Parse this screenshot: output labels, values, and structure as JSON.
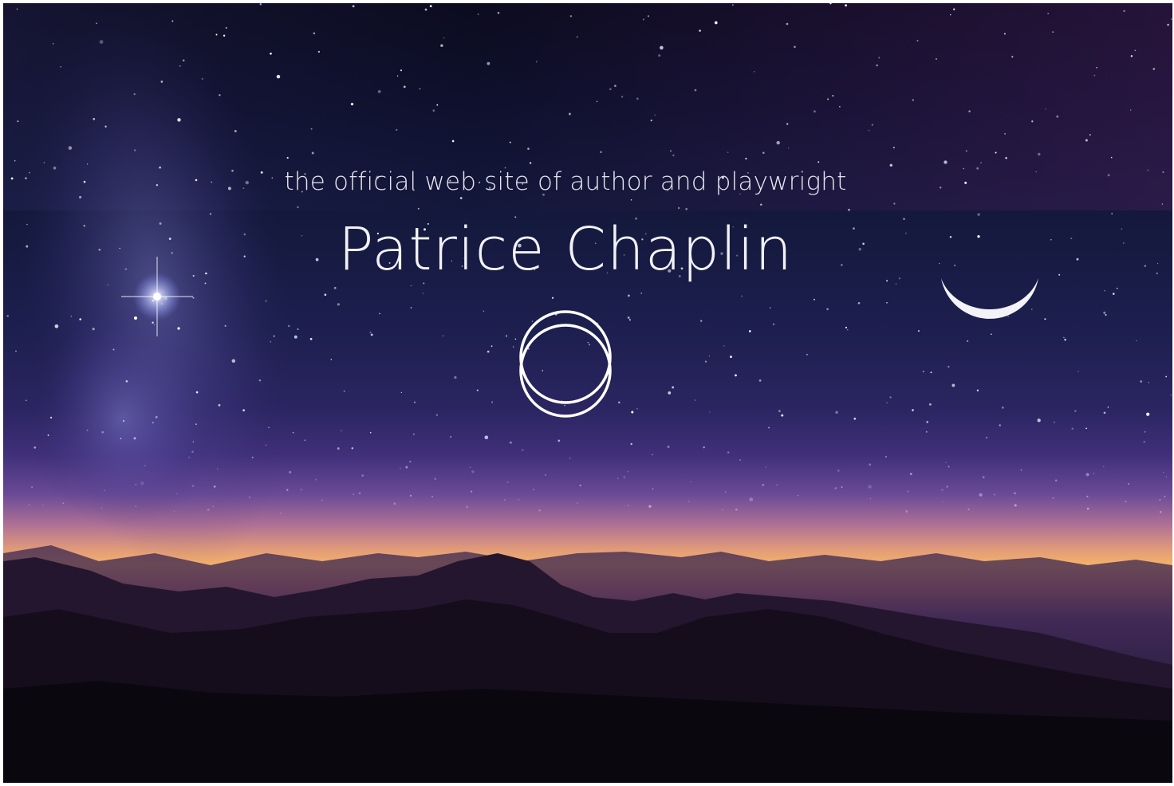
{
  "hero": {
    "tagline": "the official web site of author and playwright",
    "author_name": "Patrice Chaplin",
    "logo_icon": "double-ring-icon",
    "moon_icon": "crescent-moon-icon",
    "star_icon": "bright-star-icon",
    "background": "night-sky-over-mountains",
    "colors": {
      "text": "#f2f1f6",
      "sky_top": "#0b0a1c",
      "sky_mid": "#2b2561",
      "horizon_glow": "#f3b26a",
      "mountains": "#0f0b16"
    }
  }
}
